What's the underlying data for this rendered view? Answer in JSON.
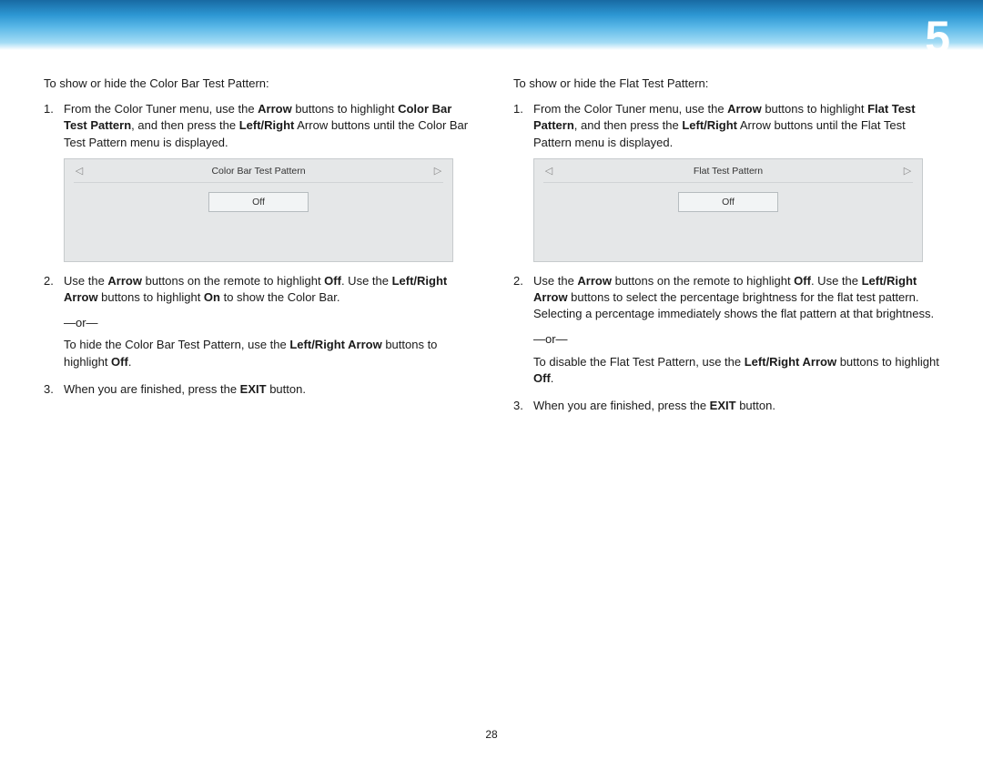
{
  "chapter": "5",
  "page_number": "28",
  "left": {
    "intro": "To show or hide the Color Bar Test Pattern:",
    "step1_a": "From the Color Tuner menu, use the ",
    "step1_b_bold": "Arrow",
    "step1_c": " buttons to highlight ",
    "step1_d_bold": "Color Bar Test Pattern",
    "step1_e": ", and then press the ",
    "step1_f_bold": "Left/Right",
    "step1_g": " Arrow buttons until the Color Bar Test Pattern menu is displayed.",
    "menu_title": "Color Bar Test Pattern",
    "menu_value": "Off",
    "step2_a": "Use the ",
    "step2_b_bold": "Arrow",
    "step2_c": " buttons on the remote to highlight ",
    "step2_d_bold": "Off",
    "step2_e": ". Use the ",
    "step2_f_bold": "Left/Right Arrow",
    "step2_g": " buttons to highlight ",
    "step2_h_bold": "On",
    "step2_i": " to show the Color Bar.",
    "or": "—or—",
    "step2_j": "To hide the Color Bar Test Pattern, use the ",
    "step2_k_bold": "Left/Right Arrow",
    "step2_l": " buttons to highlight ",
    "step2_m_bold": "Off",
    "step2_n": ".",
    "step3_a": "When you are finished, press the ",
    "step3_b_bold": "EXIT",
    "step3_c": " button."
  },
  "right": {
    "intro": "To show or hide the Flat Test Pattern:",
    "step1_a": "From the Color Tuner menu, use the ",
    "step1_b_bold": "Arrow",
    "step1_c": " buttons to highlight ",
    "step1_d_bold": "Flat Test Pattern",
    "step1_e": ", and then press the ",
    "step1_f_bold": "Left/Right",
    "step1_g": " Arrow buttons until the Flat Test Pattern menu is displayed.",
    "menu_title": "Flat Test Pattern",
    "menu_value": "Off",
    "step2_a": "Use the ",
    "step2_b_bold": "Arrow",
    "step2_c": " buttons on the remote to highlight ",
    "step2_d_bold": "Off",
    "step2_e": ". Use the ",
    "step2_f_bold": "Left/Right Arrow",
    "step2_g": " buttons to select the percentage brightness for the flat test pattern. Selecting a percentage immediately shows the flat pattern at that brightness.",
    "or": "—or—",
    "step2_j": "To disable the Flat Test Pattern, use the ",
    "step2_k_bold": "Left/Right Arrow",
    "step2_l": " buttons to highlight ",
    "step2_m_bold": "Off",
    "step2_n": ".",
    "step3_a": "When you are finished, press the ",
    "step3_b_bold": "EXIT",
    "step3_c": " button."
  },
  "glyph_left": "◁",
  "glyph_right": "▷"
}
